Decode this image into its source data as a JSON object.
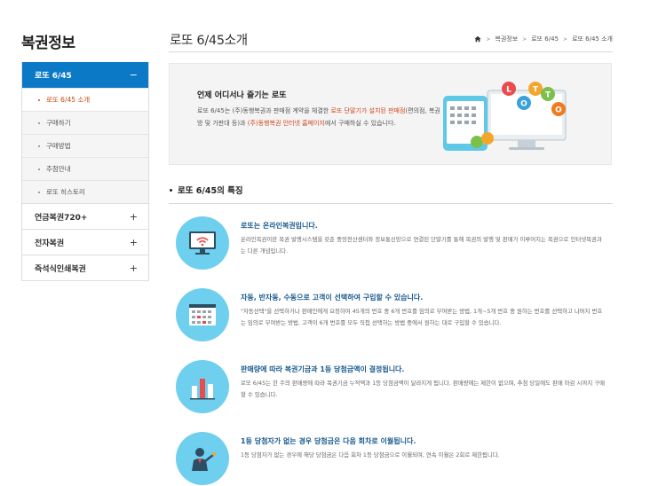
{
  "sidebar": {
    "title": "복권정보",
    "menus": [
      {
        "label": "로또 6/45",
        "sign": "−",
        "active": true
      },
      {
        "label": "연금복권720+",
        "sign": "+"
      },
      {
        "label": "전자복권",
        "sign": "+"
      },
      {
        "label": "즉석식인쇄복권",
        "sign": "+"
      }
    ],
    "lotto_subs": [
      "로또 6/45 소개",
      "구매하기",
      "구매방법",
      "추첨안내",
      "로또 히스토리"
    ]
  },
  "header": {
    "title": "로또 6/45소개",
    "breadcrumb": [
      "복권정보",
      "로또 6/45",
      "로또 6/45 소개"
    ]
  },
  "intro": {
    "heading": "언제 어디서나 즐기는 로또",
    "text_1": "로또 6/45는 (주)동행복권과 판매점 계약을 체결한 ",
    "hl_1": "로또 단말기가 설치된 판매점",
    "text_2": "(편의점, 복권방 및 가판대 등)과 ",
    "hl_2": "(주)동행복권 인터넷 홈페이지",
    "text_3": "에서 구매하실 수 있습니다.",
    "art_letters": [
      "L",
      "O",
      "T",
      "T",
      "O"
    ],
    "colors": {
      "l": "#e84c4c",
      "o1": "#3aa1dc",
      "t1": "#f3a62b",
      "t2": "#7cc04b",
      "o2": "#f07b1d"
    }
  },
  "features": {
    "title": "로또 6/45의 특징",
    "items": [
      {
        "icon": "wifi-monitor-icon",
        "title": "로또는 온라인복권입니다.",
        "desc": "온라인복권이란 복권 발행시스템을 갖춘 중앙전산센터와 정보통신망으로 연결된 단말기를 통해 복권의 발행 및 판매가 이루어지는 복권으로 인터넷복권과는 다른 개념입니다."
      },
      {
        "icon": "number-grid-icon",
        "title": "자동, 반자동, 수동으로 고객이 선택하여 구입할 수 있습니다.",
        "desc": "\"자동선택\"을 선택하거나 판매인에게 요청하여 45개의 번호 중 6개 번호를 임의로 부여받는 방법, 1개~5개 번호 중 원하는 번호를 선택하고 나머지 번호는 임의로 부여받는 방법, 고객이 6개 번호를 모두 직접 선택하는 방법 중에서 원하는 대로 구입할 수 있습니다."
      },
      {
        "icon": "bar-chart-icon",
        "title": "판매량에 따라 복권기금과 1등 당첨금액이 결정됩니다.",
        "desc": "로또 6/45는 한 주의 판매량에 따라 복권기금 누적액과 1등 당첨금액이 달라지게 됩니다. 판매량에는 제한이 없으며, 추첨 당일에도 판매 마감 시까지 구매할 수 있습니다."
      },
      {
        "icon": "presenter-icon",
        "title": "1등 당첨자가 없는 경우 당첨금은 다음 회차로 이월됩니다.",
        "desc": "1등 당첨자가 없는 경우에 해당 당첨금은 다음 회차 1등 당첨금으로 이월되며, 연속 이월은 2회로 제한됩니다."
      }
    ]
  }
}
